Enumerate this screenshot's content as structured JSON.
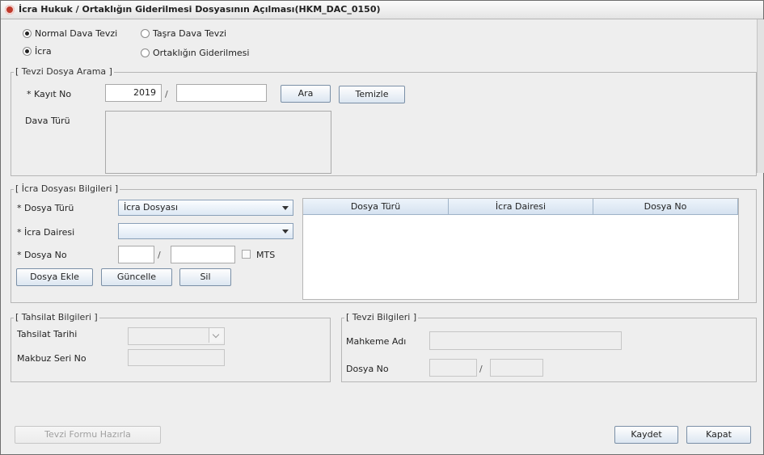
{
  "window": {
    "title": "İcra Hukuk / Ortaklığın Giderilmesi Dosyasının Açılması(HKM_DAC_0150)"
  },
  "radios": {
    "normal": {
      "label": "Normal Dava Tevzi",
      "checked": true
    },
    "tasra": {
      "label": "Taşra Dava Tevzi",
      "checked": false
    },
    "icra": {
      "label": "İcra",
      "checked": true
    },
    "ortaklik": {
      "label": "Ortaklığın Giderilmesi",
      "checked": false
    }
  },
  "tevzi_dosya_arama": {
    "legend": "[ Tevzi Dosya Arama ]",
    "kayit_no_label": "* Kayıt No",
    "year_value": "2019",
    "separator": "/",
    "number_value": "",
    "ara_button": "Ara",
    "temizle_button": "Temizle",
    "dava_turu_label": "Dava Türü"
  },
  "icra_dosyasi": {
    "legend": "[ İcra Dosyası Bilgileri ]",
    "dosya_turu_label": "* Dosya Türü",
    "dosya_turu_value": "İcra Dosyası",
    "icra_dairesi_label": "* İcra Dairesi",
    "icra_dairesi_value": "",
    "dosya_no_label": "* Dosya No",
    "separator": "/",
    "mts_label": "MTS",
    "dosya_ekle_button": "Dosya Ekle",
    "guncelle_button": "Güncelle",
    "sil_button": "Sil",
    "table_columns": [
      "Dosya Türü",
      "İcra Dairesi",
      "Dosya No"
    ],
    "table_rows": []
  },
  "tahsilat": {
    "legend": "[ Tahsilat Bilgileri ]",
    "tarih_label": "Tahsilat Tarihi",
    "makbuz_label": "Makbuz Seri No"
  },
  "tevzi_bilgileri": {
    "legend": "[ Tevzi Bilgileri ]",
    "mahkeme_label": "Mahkeme Adı",
    "dosya_no_label": "Dosya No",
    "separator": "/"
  },
  "footer": {
    "tevzi_formu_button": "Tevzi Formu Hazırla",
    "kaydet_button": "Kaydet",
    "kapat_button": "Kapat"
  },
  "colors": {
    "window_bg": "#eeeeee",
    "button_border": "#7a8fa6",
    "header_bg": "#d5e2f0"
  }
}
